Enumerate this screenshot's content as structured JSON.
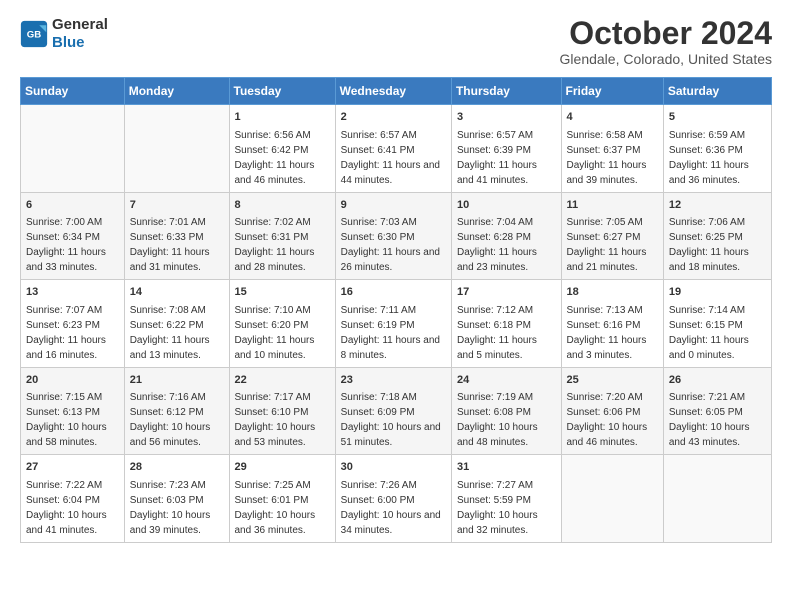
{
  "header": {
    "logo_line1": "General",
    "logo_line2": "Blue",
    "title": "October 2024",
    "subtitle": "Glendale, Colorado, United States"
  },
  "calendar": {
    "days_of_week": [
      "Sunday",
      "Monday",
      "Tuesday",
      "Wednesday",
      "Thursday",
      "Friday",
      "Saturday"
    ],
    "weeks": [
      [
        {
          "day": "",
          "data": ""
        },
        {
          "day": "",
          "data": ""
        },
        {
          "day": "1",
          "data": "Sunrise: 6:56 AM\nSunset: 6:42 PM\nDaylight: 11 hours and 46 minutes."
        },
        {
          "day": "2",
          "data": "Sunrise: 6:57 AM\nSunset: 6:41 PM\nDaylight: 11 hours and 44 minutes."
        },
        {
          "day": "3",
          "data": "Sunrise: 6:57 AM\nSunset: 6:39 PM\nDaylight: 11 hours and 41 minutes."
        },
        {
          "day": "4",
          "data": "Sunrise: 6:58 AM\nSunset: 6:37 PM\nDaylight: 11 hours and 39 minutes."
        },
        {
          "day": "5",
          "data": "Sunrise: 6:59 AM\nSunset: 6:36 PM\nDaylight: 11 hours and 36 minutes."
        }
      ],
      [
        {
          "day": "6",
          "data": "Sunrise: 7:00 AM\nSunset: 6:34 PM\nDaylight: 11 hours and 33 minutes."
        },
        {
          "day": "7",
          "data": "Sunrise: 7:01 AM\nSunset: 6:33 PM\nDaylight: 11 hours and 31 minutes."
        },
        {
          "day": "8",
          "data": "Sunrise: 7:02 AM\nSunset: 6:31 PM\nDaylight: 11 hours and 28 minutes."
        },
        {
          "day": "9",
          "data": "Sunrise: 7:03 AM\nSunset: 6:30 PM\nDaylight: 11 hours and 26 minutes."
        },
        {
          "day": "10",
          "data": "Sunrise: 7:04 AM\nSunset: 6:28 PM\nDaylight: 11 hours and 23 minutes."
        },
        {
          "day": "11",
          "data": "Sunrise: 7:05 AM\nSunset: 6:27 PM\nDaylight: 11 hours and 21 minutes."
        },
        {
          "day": "12",
          "data": "Sunrise: 7:06 AM\nSunset: 6:25 PM\nDaylight: 11 hours and 18 minutes."
        }
      ],
      [
        {
          "day": "13",
          "data": "Sunrise: 7:07 AM\nSunset: 6:23 PM\nDaylight: 11 hours and 16 minutes."
        },
        {
          "day": "14",
          "data": "Sunrise: 7:08 AM\nSunset: 6:22 PM\nDaylight: 11 hours and 13 minutes."
        },
        {
          "day": "15",
          "data": "Sunrise: 7:10 AM\nSunset: 6:20 PM\nDaylight: 11 hours and 10 minutes."
        },
        {
          "day": "16",
          "data": "Sunrise: 7:11 AM\nSunset: 6:19 PM\nDaylight: 11 hours and 8 minutes."
        },
        {
          "day": "17",
          "data": "Sunrise: 7:12 AM\nSunset: 6:18 PM\nDaylight: 11 hours and 5 minutes."
        },
        {
          "day": "18",
          "data": "Sunrise: 7:13 AM\nSunset: 6:16 PM\nDaylight: 11 hours and 3 minutes."
        },
        {
          "day": "19",
          "data": "Sunrise: 7:14 AM\nSunset: 6:15 PM\nDaylight: 11 hours and 0 minutes."
        }
      ],
      [
        {
          "day": "20",
          "data": "Sunrise: 7:15 AM\nSunset: 6:13 PM\nDaylight: 10 hours and 58 minutes."
        },
        {
          "day": "21",
          "data": "Sunrise: 7:16 AM\nSunset: 6:12 PM\nDaylight: 10 hours and 56 minutes."
        },
        {
          "day": "22",
          "data": "Sunrise: 7:17 AM\nSunset: 6:10 PM\nDaylight: 10 hours and 53 minutes."
        },
        {
          "day": "23",
          "data": "Sunrise: 7:18 AM\nSunset: 6:09 PM\nDaylight: 10 hours and 51 minutes."
        },
        {
          "day": "24",
          "data": "Sunrise: 7:19 AM\nSunset: 6:08 PM\nDaylight: 10 hours and 48 minutes."
        },
        {
          "day": "25",
          "data": "Sunrise: 7:20 AM\nSunset: 6:06 PM\nDaylight: 10 hours and 46 minutes."
        },
        {
          "day": "26",
          "data": "Sunrise: 7:21 AM\nSunset: 6:05 PM\nDaylight: 10 hours and 43 minutes."
        }
      ],
      [
        {
          "day": "27",
          "data": "Sunrise: 7:22 AM\nSunset: 6:04 PM\nDaylight: 10 hours and 41 minutes."
        },
        {
          "day": "28",
          "data": "Sunrise: 7:23 AM\nSunset: 6:03 PM\nDaylight: 10 hours and 39 minutes."
        },
        {
          "day": "29",
          "data": "Sunrise: 7:25 AM\nSunset: 6:01 PM\nDaylight: 10 hours and 36 minutes."
        },
        {
          "day": "30",
          "data": "Sunrise: 7:26 AM\nSunset: 6:00 PM\nDaylight: 10 hours and 34 minutes."
        },
        {
          "day": "31",
          "data": "Sunrise: 7:27 AM\nSunset: 5:59 PM\nDaylight: 10 hours and 32 minutes."
        },
        {
          "day": "",
          "data": ""
        },
        {
          "day": "",
          "data": ""
        }
      ]
    ]
  }
}
